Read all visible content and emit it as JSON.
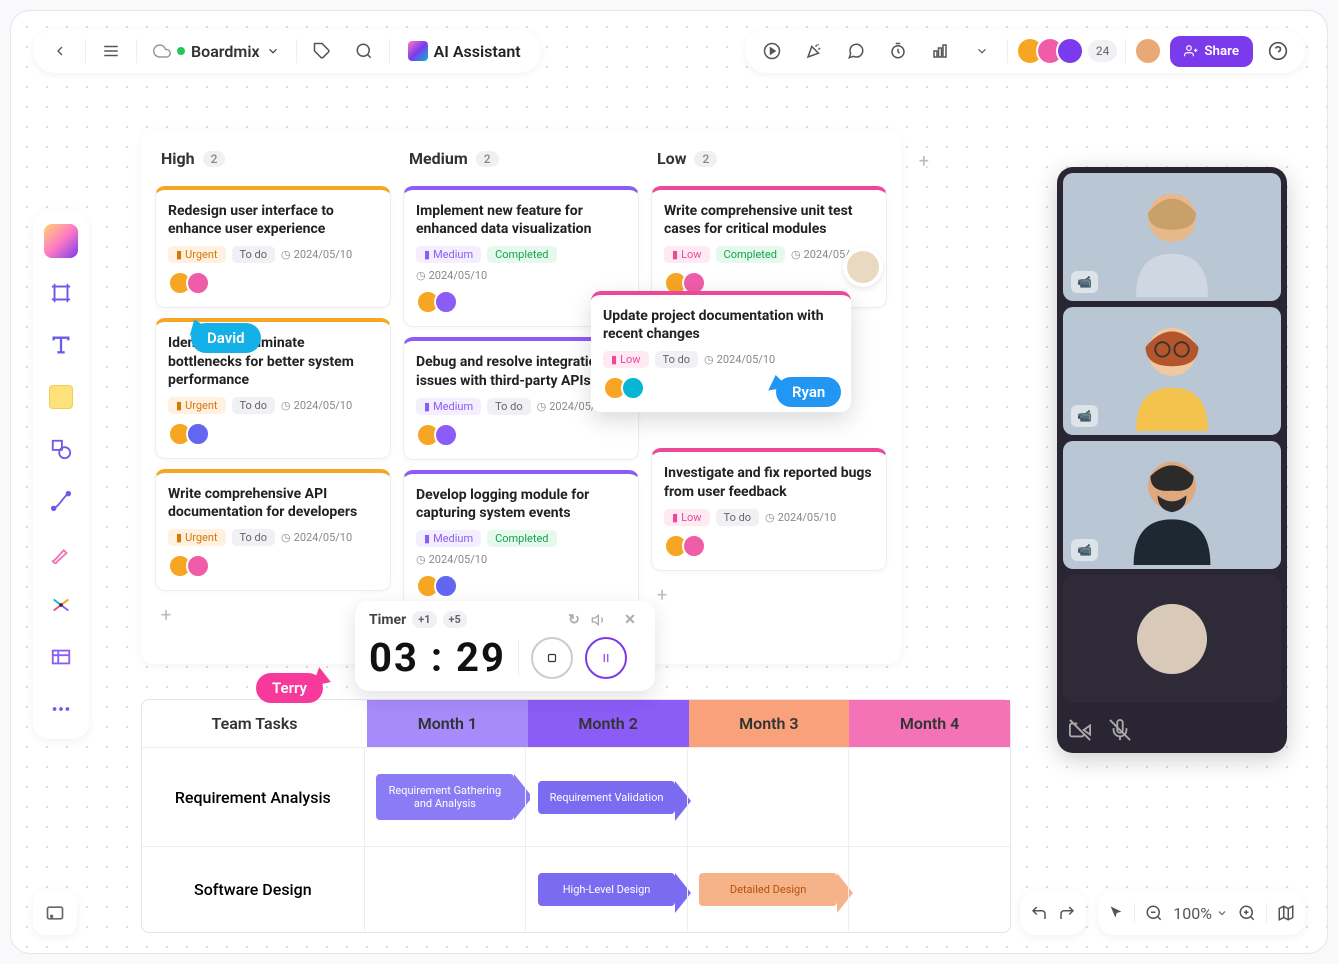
{
  "header": {
    "brand": "Boardmix",
    "ai_label": "AI Assistant",
    "participant_count": "24",
    "share_label": "Share"
  },
  "board": {
    "columns": [
      {
        "title": "High",
        "count": "2"
      },
      {
        "title": "Medium",
        "count": "2"
      },
      {
        "title": "Low",
        "count": "2"
      }
    ],
    "cards": {
      "high": [
        {
          "title": "Redesign user interface to enhance user experience",
          "priority": "Urgent",
          "status": "To do",
          "date": "2024/05/10"
        },
        {
          "title": "Identify and eliminate bottlenecks for better system performance",
          "priority": "Urgent",
          "status": "To do",
          "date": "2024/05/10"
        },
        {
          "title": "Write comprehensive API documentation for developers",
          "priority": "Urgent",
          "status": "To do",
          "date": "2024/05/10"
        }
      ],
      "medium": [
        {
          "title": "Implement new feature for enhanced data visualization",
          "priority": "Medium",
          "status": "Completed",
          "date": "2024/05/10"
        },
        {
          "title": "Debug and resolve integration issues with third-party APIs",
          "priority": "Medium",
          "status": "To do",
          "date": "2024/05/10"
        },
        {
          "title": "Develop logging module for capturing system events",
          "priority": "Medium",
          "status": "Completed",
          "date": "2024/05/10"
        }
      ],
      "low": [
        {
          "title": "Write comprehensive unit test cases for critical modules",
          "priority": "Low",
          "status": "Completed",
          "date": "2024/05/10"
        },
        {
          "title": "Investigate and fix reported bugs from user feedback",
          "priority": "Low",
          "status": "To do",
          "date": "2024/05/10"
        }
      ]
    },
    "floating_card": {
      "title": "Update project documentation with recent changes",
      "priority": "Low",
      "status": "To do",
      "date": "2024/05/10"
    }
  },
  "cursors": {
    "david": "David",
    "ryan": "Ryan",
    "terry": "Terry"
  },
  "timer": {
    "label": "Timer",
    "plus1": "+1",
    "plus5": "+5",
    "time": "03 : 29"
  },
  "gantt": {
    "header": {
      "tasks": "Team Tasks",
      "m1": "Month 1",
      "m2": "Month 2",
      "m3": "Month 3",
      "m4": "Month 4"
    },
    "rows": [
      {
        "label": "Requirement Analysis",
        "items": [
          "Requirement Gathering and Analysis",
          "Requirement Validation"
        ]
      },
      {
        "label": "Software Design",
        "items": [
          "High-Level Design",
          "Detailed Design"
        ]
      }
    ]
  },
  "zoom": {
    "percent": "100%"
  },
  "avatar_colors": [
    "#f6a623",
    "#ef5da8",
    "#7c3aed",
    "#2dd4bf"
  ]
}
